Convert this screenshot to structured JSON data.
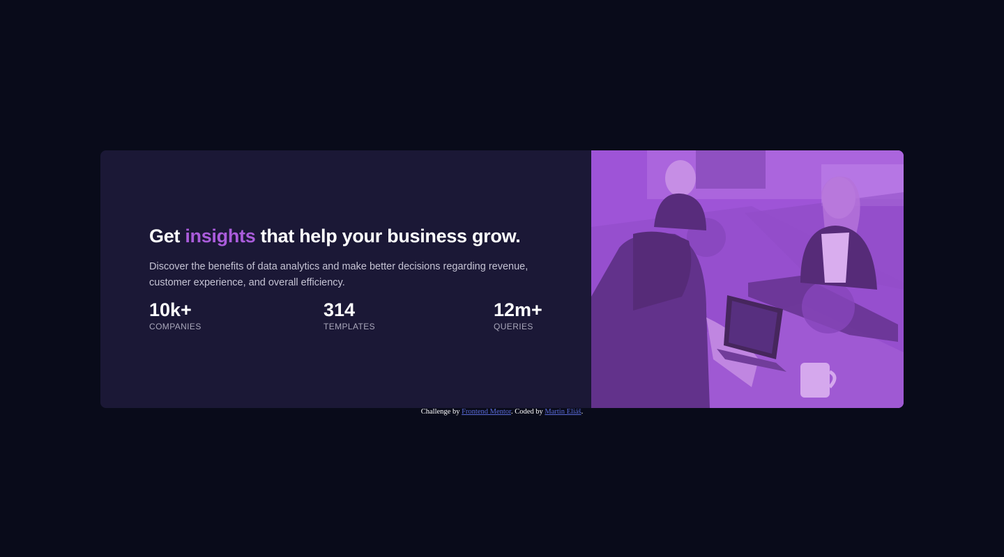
{
  "hero": {
    "title_prefix": "Get ",
    "title_accent": "insights",
    "title_suffix": " that help your business grow.",
    "description": "Discover the benefits of data analytics and make better decisions regarding revenue, customer experience, and overall efficiency."
  },
  "stats": [
    {
      "value": "10k+",
      "label": "COMPANIES"
    },
    {
      "value": "314",
      "label": "TEMPLATES"
    },
    {
      "value": "12m+",
      "label": "QUERIES"
    }
  ],
  "attribution": {
    "prefix": "Challenge by ",
    "link1": "Frontend Mentor",
    "middle": ". Coded by ",
    "link2": "Martin Eliáš",
    "suffix": "."
  },
  "colors": {
    "background": "#090b1a",
    "card": "#1b1836",
    "accent": "#aa5cdb",
    "image_overlay": "#9a52d6"
  }
}
